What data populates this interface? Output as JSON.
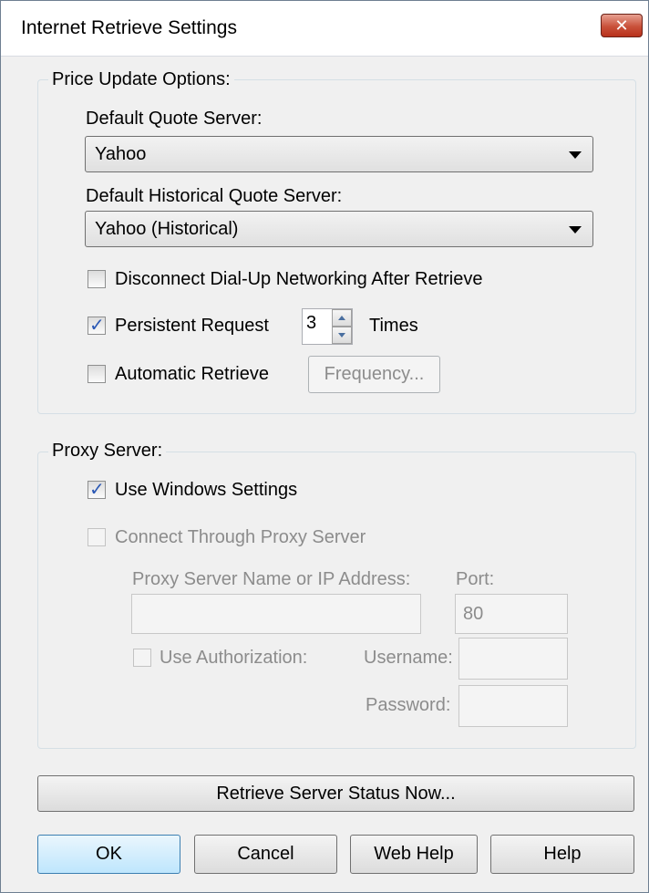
{
  "window": {
    "title": "Internet Retrieve Settings",
    "close_icon": "close-icon"
  },
  "price_update": {
    "group_label": "Price Update Options:",
    "quote_server_label": "Default Quote Server:",
    "quote_server_value": "Yahoo",
    "historical_server_label": "Default Historical Quote Server:",
    "historical_server_value": "Yahoo (Historical)",
    "disconnect_label": "Disconnect Dial-Up Networking After Retrieve",
    "disconnect_checked": false,
    "persistent_label": "Persistent Request",
    "persistent_checked": true,
    "persistent_count": "3",
    "times_label": "Times",
    "automatic_label": "Automatic Retrieve",
    "automatic_checked": false,
    "frequency_button": "Frequency..."
  },
  "proxy": {
    "group_label": "Proxy Server:",
    "use_windows_label": "Use Windows Settings",
    "use_windows_checked": true,
    "connect_label": "Connect Through Proxy Server",
    "connect_checked": false,
    "server_name_label": "Proxy Server Name or IP Address:",
    "server_name_value": "",
    "port_label": "Port:",
    "port_value": "80",
    "use_auth_label": "Use Authorization:",
    "use_auth_checked": false,
    "username_label": "Username:",
    "password_label": "Password:"
  },
  "buttons": {
    "retrieve_status": "Retrieve Server Status Now...",
    "ok": "OK",
    "cancel": "Cancel",
    "web_help": "Web Help",
    "help": "Help"
  }
}
